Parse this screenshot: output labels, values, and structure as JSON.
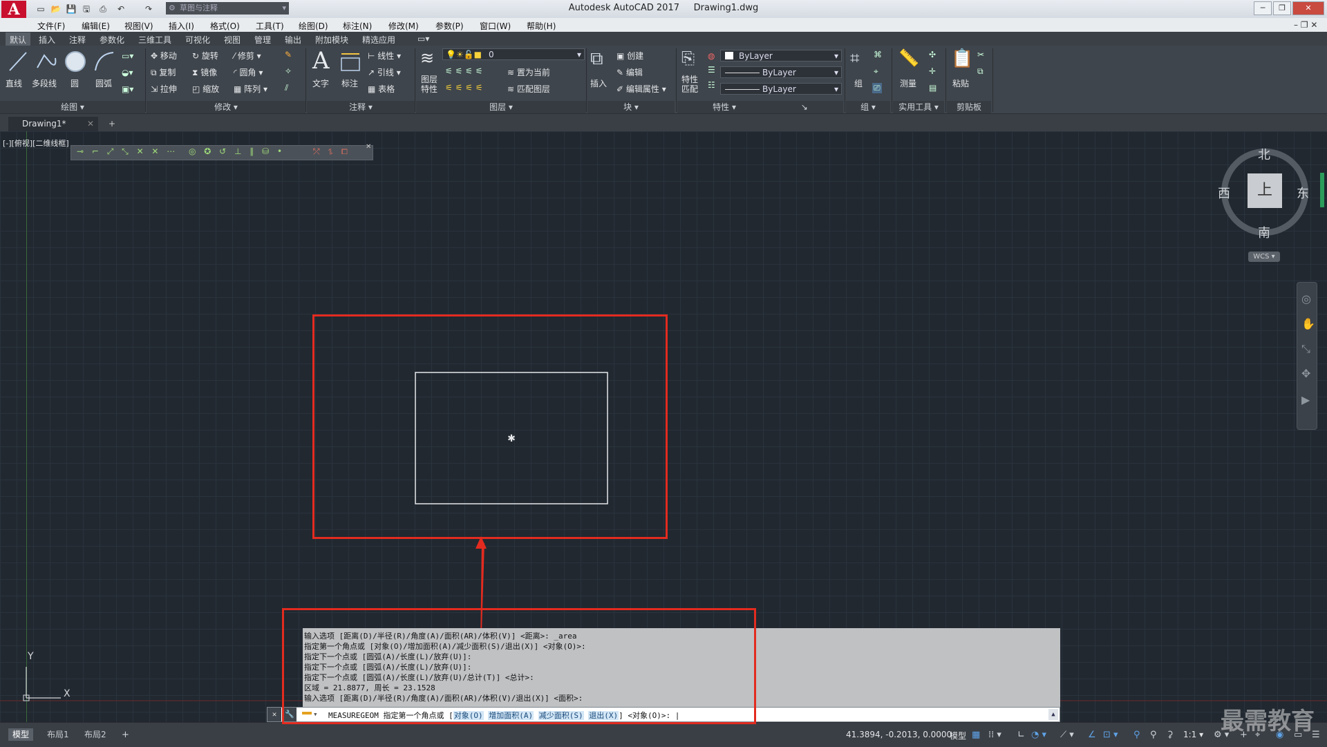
{
  "app": {
    "logo": "A",
    "workspace": "草图与注释",
    "title": "Autodesk AutoCAD 2017",
    "filename": "Drawing1.dwg"
  },
  "menu": [
    "文件(F)",
    "编辑(E)",
    "视图(V)",
    "插入(I)",
    "格式(O)",
    "工具(T)",
    "绘图(D)",
    "标注(N)",
    "修改(M)",
    "参数(P)",
    "窗口(W)",
    "帮助(H)"
  ],
  "ribbon_tabs": [
    "默认",
    "插入",
    "注释",
    "参数化",
    "三维工具",
    "可视化",
    "视图",
    "管理",
    "输出",
    "附加模块",
    "精选应用"
  ],
  "ribbon": {
    "draw": {
      "title": "绘图",
      "line": "直线",
      "polyline": "多段线",
      "circle": "圆",
      "arc": "圆弧"
    },
    "modify": {
      "title": "修改",
      "move": "移动",
      "rotate": "旋转",
      "trim": "修剪",
      "copy": "复制",
      "mirror": "镜像",
      "fillet": "圆角",
      "stretch": "拉伸",
      "scale": "缩放",
      "array": "阵列"
    },
    "annotation": {
      "title": "注释",
      "text": "文字",
      "dimension": "标注",
      "linear": "线性",
      "leader": "引线",
      "table": "表格"
    },
    "layers": {
      "title": "图层",
      "layer_props": "图层特性",
      "layer_value": "0",
      "set_current": "置为当前",
      "match_layer": "匹配图层"
    },
    "block": {
      "title": "块",
      "insert": "插入",
      "create": "创建",
      "edit": "编辑",
      "edit_attr": "编辑属性"
    },
    "properties": {
      "title": "特性",
      "match": "特性匹配",
      "color": "ByLayer",
      "linetype": "ByLayer",
      "lineweight": "ByLayer"
    },
    "group": {
      "title": "组",
      "group": "组"
    },
    "utilities": {
      "title": "实用工具",
      "measure": "测量"
    },
    "clipboard": {
      "title": "剪贴板",
      "paste": "粘贴"
    }
  },
  "doc_tab": "Drawing1*",
  "viewport_label": "[-][俯视][二维线框]",
  "viewcube": {
    "north": "北",
    "south": "南",
    "east": "东",
    "west": "西",
    "face": "上",
    "wcs": "WCS"
  },
  "ucs": {
    "x": "X",
    "y": "Y"
  },
  "command_history": [
    "输入选项 [距离(D)/半径(R)/角度(A)/面积(AR)/体积(V)] <距离>: _area",
    "指定第一个角点或 [对象(O)/增加面积(A)/减少面积(S)/退出(X)] <对象(O)>:",
    "指定下一个点或 [圆弧(A)/长度(L)/放弃(U)]:",
    "指定下一个点或 [圆弧(A)/长度(L)/放弃(U)]:",
    "指定下一个点或 [圆弧(A)/长度(L)/放弃(U)/总计(T)] <总计>:",
    "区域 = 21.8877, 周长 = 23.1528",
    "输入选项 [距离(D)/半径(R)/角度(A)/面积(AR)/体积(V)/退出(X)] <面积>:"
  ],
  "command_line": {
    "prefix": "MEASUREGEOM 指定第一个角点或 [",
    "opt1": "对象(O)",
    "opt2": "增加面积(A)",
    "opt3": "减少面积(S)",
    "opt4": "退出(X)",
    "suffix": "] <对象(O)>:"
  },
  "status": {
    "layout_tabs": [
      "模型",
      "布局1",
      "布局2"
    ],
    "coords": "41.3894, -0.2013, 0.0000",
    "mode": "模型",
    "scale": "1:1"
  },
  "watermark": "最需教育",
  "colors": {
    "canvas": "#212830",
    "annotation_red": "#e32b1f",
    "accent_logo": "#c8102e"
  }
}
